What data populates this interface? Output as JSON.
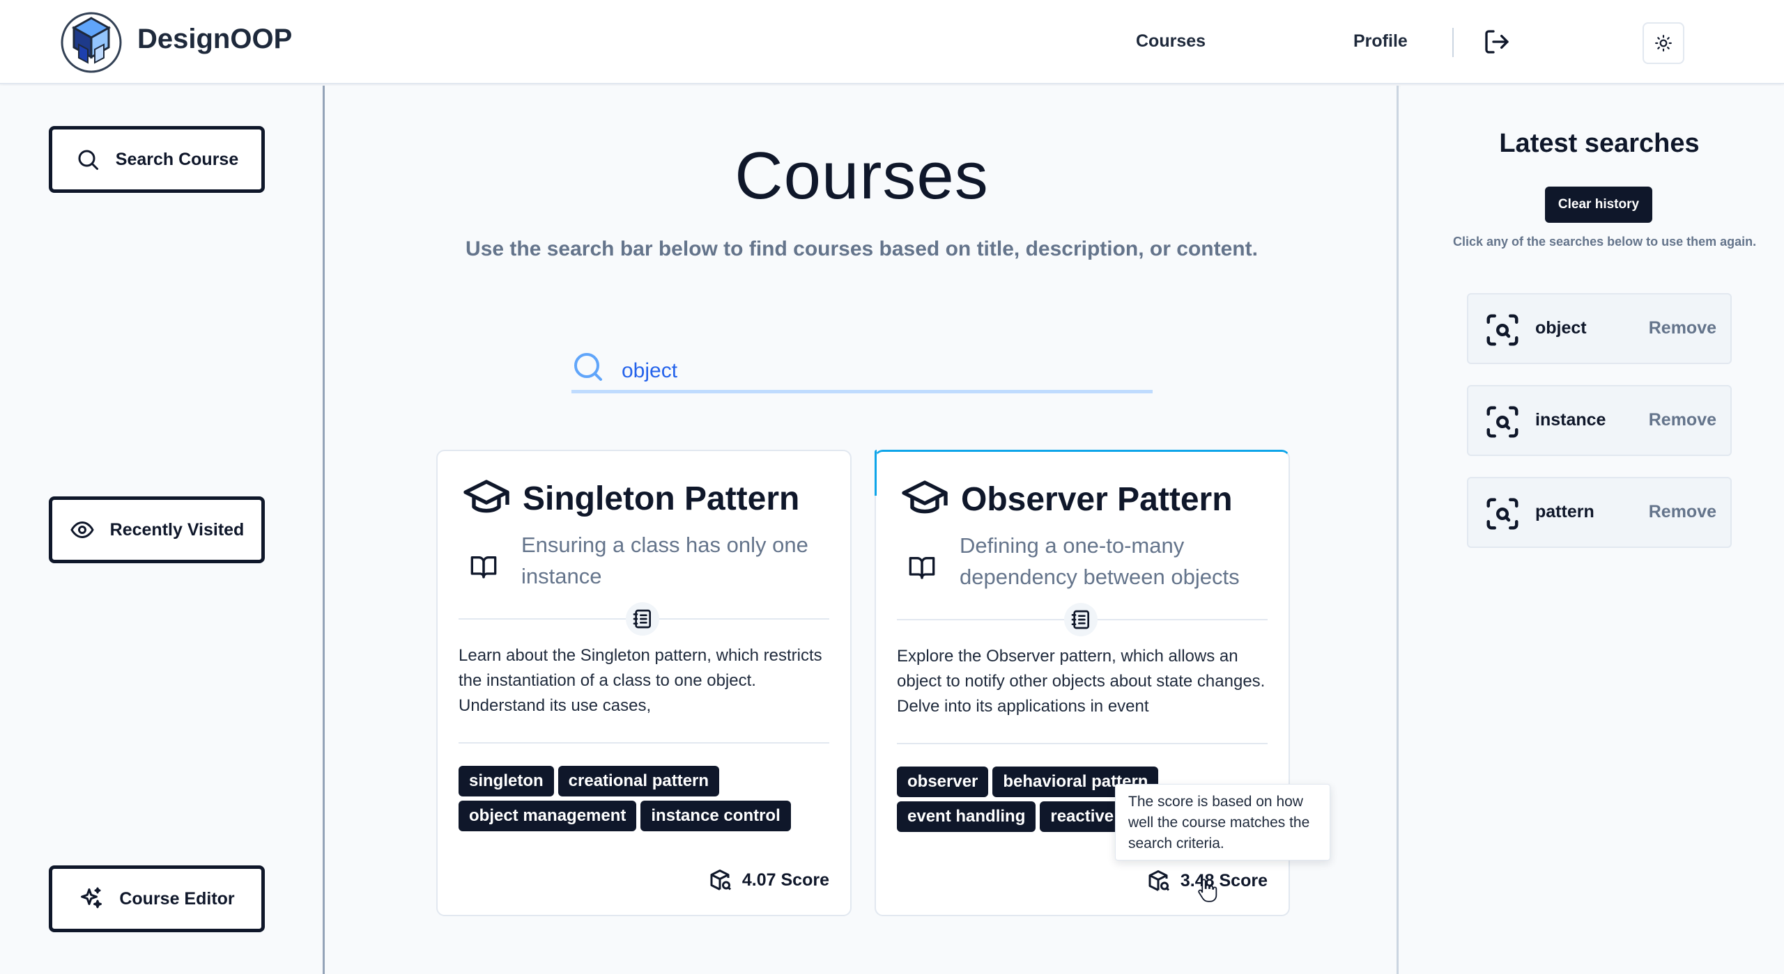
{
  "header": {
    "brand": "DesignOOP",
    "nav": {
      "courses": "Courses",
      "profile": "Profile"
    }
  },
  "sidebar": {
    "search_course": "Search Course",
    "recently_visited": "Recently Visited",
    "course_editor": "Course Editor"
  },
  "main": {
    "title": "Courses",
    "subtitle": "Use the search bar below to find courses based on title, description, or content.",
    "search": {
      "value": "object"
    },
    "cards": [
      {
        "title": "Singleton Pattern",
        "subtitle": "Ensuring a class has only one instance",
        "description": "Learn about the Singleton pattern, which restricts the instantiation of a class to one object. Understand its use cases,",
        "tags": [
          "singleton",
          "creational pattern",
          "object management",
          "instance control"
        ],
        "score": "4.07 Score"
      },
      {
        "title": "Observer Pattern",
        "subtitle": "Defining a one-to-many dependency between objects",
        "description": "Explore the Observer pattern, which allows an object to notify other objects about state changes. Delve into its applications in event",
        "tags": [
          "observer",
          "behavioral pattern",
          "event handling",
          "reactive"
        ],
        "score": "3.48 Score"
      }
    ],
    "tooltip": "The score is based on how well the course matches the search criteria."
  },
  "history": {
    "title": "Latest searches",
    "clear_label": "Clear history",
    "hint": "Click any of the searches below to use them again.",
    "remove_label": "Remove",
    "items": [
      "object",
      "instance",
      "pattern"
    ]
  },
  "colors": {
    "primary": "#0f172a",
    "muted": "#64748b",
    "accent": "#0ea5e9",
    "search_text": "#2563eb"
  }
}
